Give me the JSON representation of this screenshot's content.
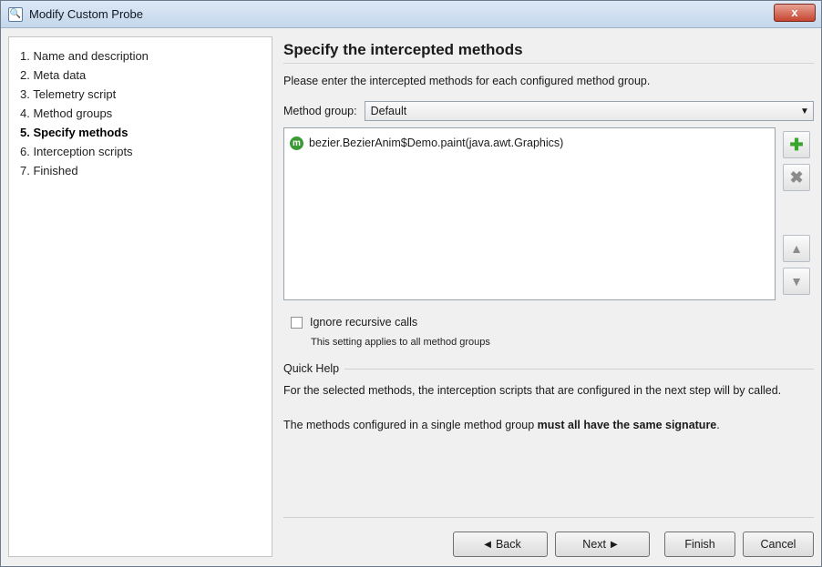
{
  "window": {
    "title": "Modify Custom Probe",
    "close_label": "x"
  },
  "steps": [
    {
      "label": "1. Name and description",
      "active": false
    },
    {
      "label": "2. Meta data",
      "active": false
    },
    {
      "label": "3. Telemetry script",
      "active": false
    },
    {
      "label": "4. Method groups",
      "active": false
    },
    {
      "label": "5. Specify methods",
      "active": true
    },
    {
      "label": "6. Interception scripts",
      "active": false
    },
    {
      "label": "7. Finished",
      "active": false
    }
  ],
  "main": {
    "heading": "Specify the intercepted methods",
    "subtext": "Please enter the intercepted methods for each configured method group.",
    "method_group_label": "Method group:",
    "method_group_value": "Default",
    "methods": [
      {
        "icon": "method-icon",
        "label": "bezier.BezierAnim$Demo.paint(java.awt.Graphics)"
      }
    ],
    "ignore_recursive_label": "Ignore recursive calls",
    "ignore_recursive_checked": false,
    "ignore_recursive_note": "This setting applies to all method groups"
  },
  "quick_help": {
    "title": "Quick Help",
    "text1": "For the selected methods, the interception scripts that are configured in the next step will by called.",
    "text2_plain": "The methods configured in a single method group ",
    "text2_bold": "must all have the same signature",
    "text2_end": "."
  },
  "buttons": {
    "back": "Back",
    "next": "Next",
    "finish": "Finish",
    "cancel": "Cancel"
  },
  "colors": {
    "add": "#3aa52c",
    "method_icon": "#3c9a35",
    "close": "#c6452f"
  }
}
